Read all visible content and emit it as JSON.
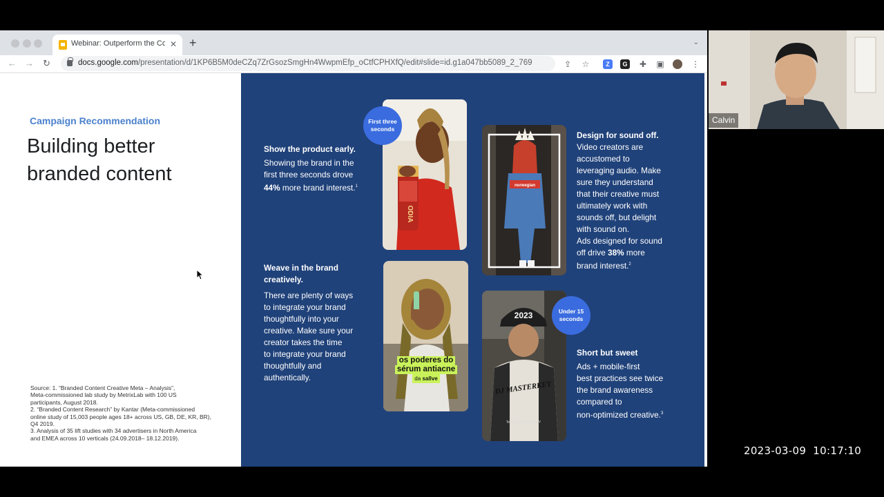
{
  "browser": {
    "tab_title": "Webinar: Outperform the Comp",
    "url_host": "docs.google.com",
    "url_path": "/presentation/d/1KP6B5M0deCZq7ZrGsozSmgHn4WwpmEfp_oCtfCPHXfQ/edit#slide=id.g1a047bb5089_2_769",
    "icons": [
      "back-icon",
      "forward-icon",
      "reload-icon",
      "share-icon",
      "star-icon",
      "extension-z-icon",
      "extension-g-icon",
      "puzzle-icon",
      "sidebar-icon",
      "profile-avatar",
      "kebab-menu-icon"
    ]
  },
  "slide": {
    "eyebrow": "Campaign Recommendation",
    "headline_line1": "Building better",
    "headline_line2": "branded content",
    "source": {
      "line1": "Source: 1. “Branded Content Creative Meta – Analysis”,",
      "line2": "Meta-commissioned lab study by MetrixLab with 100 US",
      "line3": "participants, August 2018.",
      "line4": "2. “Branded Content Research” by Kantar (Meta-commissioned",
      "line5": "online study of 15,003 people ages 18+ across US, GB, DE, KR, BR),",
      "line6": "Q4 2019.",
      "line7": "3. Analysis of 35 lift studies with 34 advertisers in North America",
      "line8": "and EMEA across 10 verticals (24.09.2018– 18.12.2019)."
    },
    "block1": {
      "heading": "Show the product early.",
      "l1": "Showing the brand in the",
      "l2": "first three seconds drove",
      "stat": "44%",
      "l3": " more brand interest.",
      "sup": "1"
    },
    "block2": {
      "heading": "Design for sound off.",
      "l1": "Video creators are",
      "l2": "accustomed to",
      "l3": "leveraging audio. Make",
      "l4": "sure they understand",
      "l5": "that their creative must",
      "l6": "ultimately work with",
      "l7": "sounds off, but delight",
      "l8": "with sound on.",
      "l9": "Ads designed for sound",
      "l10a": "off drive ",
      "stat": "38%",
      "l10b": " more",
      "l11": "brand interest.",
      "sup": "2"
    },
    "block3": {
      "heading1": "Weave in the brand",
      "heading2": "creatively.",
      "l1": "There are plenty of ways",
      "l2": "to integrate your brand",
      "l3": "thoughtfully into your",
      "l4": "creative. Make sure your",
      "l5": "creator takes the time",
      "l6": "to integrate your brand",
      "l7": "thoughtfully and",
      "l8": "authentically."
    },
    "block4": {
      "heading": "Short but sweet",
      "l1": "Ads + mobile-first",
      "l2": "best practices see twice",
      "l3": "the brand awareness",
      "l4": "compared to",
      "l5": "non-optimized creative.",
      "sup": "3"
    },
    "badge1": {
      "l1": "First three",
      "l2": "seconds"
    },
    "badge2": {
      "l1": "Under 15",
      "l2": "seconds"
    },
    "photo_texts": {
      "norwegian": "norwegian",
      "serum1": "os poderes do",
      "serum2": "sérum antiacne",
      "serum3": "da",
      "serum_brand": "sallve",
      "bottle": "ODIA",
      "cap": "2023",
      "shirt": "DJ MASTERKEY",
      "caption": "Text: DJ MASTERKEY"
    }
  },
  "webcam": {
    "name": "Calvin"
  },
  "timestamp": "2023-03-09  10:17:10"
}
